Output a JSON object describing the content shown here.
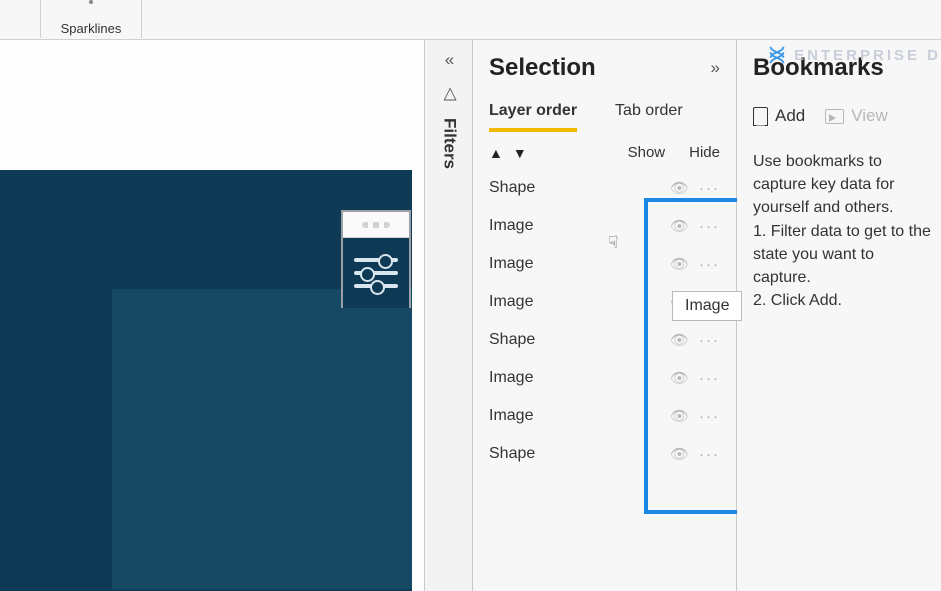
{
  "ribbon": {
    "sparklines": "Sparklines"
  },
  "filters": {
    "label": "Filters"
  },
  "selection": {
    "title": "Selection",
    "tab_layer": "Layer order",
    "tab_tab": "Tab order",
    "col_show": "Show",
    "col_hide": "Hide",
    "tooltip": "Image",
    "items": [
      {
        "name": "Shape"
      },
      {
        "name": "Image"
      },
      {
        "name": "Image"
      },
      {
        "name": "Image"
      },
      {
        "name": "Shape"
      },
      {
        "name": "Image"
      },
      {
        "name": "Image"
      },
      {
        "name": "Shape"
      }
    ]
  },
  "bookmarks": {
    "title": "Bookmarks",
    "add": "Add",
    "view": "View",
    "help": "Use bookmarks to capture key data for yourself and others.\n1. Filter data to get to the state you want to capture.\n2. Click Add."
  },
  "watermark": "ENTERPRISE D"
}
